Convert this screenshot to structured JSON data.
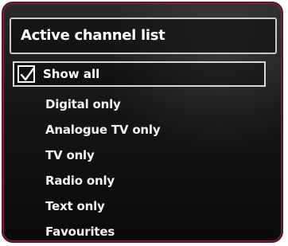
{
  "panel": {
    "title": "Active channel list",
    "show_all": {
      "label": "Show all",
      "checked": true
    },
    "options": [
      "Digital only",
      "Analogue TV only",
      "TV only",
      "Radio only",
      "Text only",
      "Favourites"
    ]
  },
  "colors": {
    "frame_border": "#5a1430",
    "background": "#151515",
    "text": "#ffffff",
    "highlight_border": "#d8d8d8"
  }
}
